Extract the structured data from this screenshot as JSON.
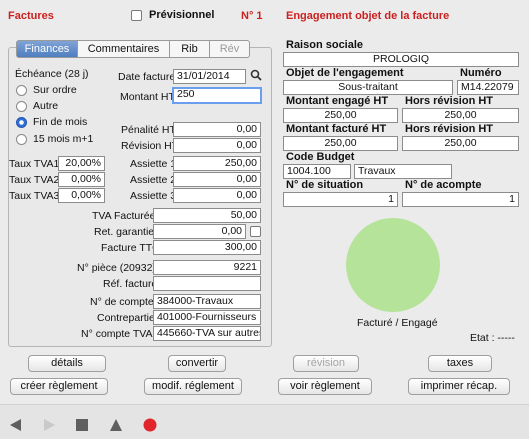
{
  "header": {
    "title": "Factures",
    "previsionnel_label": "Prévisionnel",
    "number": "N° 1",
    "engagement_title": "Engagement objet de la facture"
  },
  "tabs": [
    {
      "label": "Finances"
    },
    {
      "label": "Commentaires"
    },
    {
      "label": "Rib"
    },
    {
      "label": "Rév"
    }
  ],
  "finances": {
    "echeance_label": "Échéance (28 j)",
    "radios": [
      "Sur ordre",
      "Autre",
      "Fin de mois",
      "15 mois m+1"
    ],
    "date_facture_label": "Date facture",
    "date_facture": "31/01/2014",
    "montant_ht_label": "Montant HT",
    "montant_ht": "250",
    "penalite_label": "Pénalité HT",
    "penalite": "0,00",
    "revision_label": "Révision HT",
    "revision": "0,00",
    "tva": [
      {
        "label": "Taux TVA1",
        "rate": "20,00%",
        "assiette_label": "Assiette 1",
        "assiette": "250,00"
      },
      {
        "label": "Taux TVA2",
        "rate": "0,00%",
        "assiette_label": "Assiette 2",
        "assiette": "0,00"
      },
      {
        "label": "Taux TVA3",
        "rate": "0,00%",
        "assiette_label": "Assiette 3",
        "assiette": "0,00"
      }
    ],
    "tva_facturee_label": "TVA Facturée",
    "tva_facturee": "50,00",
    "ret_garantie_label": "Ret. garantie",
    "ret_garantie": "0,00",
    "facture_ttc_label": "Facture TTC",
    "facture_ttc": "300,00",
    "piece_label": "N° pièce (20932)",
    "piece": "9221",
    "ref_facture_label": "Réf. facture",
    "ref_facture": "",
    "compte_label": "N° de compte",
    "compte": "384000-Travaux",
    "contrepartie_label": "Contrepartie",
    "contrepartie": "401000-Fournisseurs",
    "compte_tva_label": "N° compte  TVA",
    "compte_tva": "445660-TVA sur autres b"
  },
  "engagement": {
    "raison_sociale_label": "Raison sociale",
    "raison_sociale": "PROLOGIQ",
    "objet_label": "Objet de l'engagement",
    "objet": "Sous-traitant",
    "numero_label": "Numéro",
    "numero": "M14.22079",
    "montant_engage_label": "Montant engagé HT",
    "montant_engage": "250,00",
    "hors_revision_label": "Hors révision HT",
    "hors_revision_1": "250,00",
    "montant_facture_label": "Montant facturé HT",
    "montant_facture": "250,00",
    "hors_revision_2": "250,00",
    "code_budget_label": "Code Budget",
    "code_budget": "1004.100",
    "code_budget_desc": "Travaux",
    "situation_label": "N° de situation",
    "situation": "1",
    "acompte_label": "N° de acompte",
    "acompte": "1",
    "pie_caption": "Facturé / Engagé",
    "pie_color": "#b6e39a",
    "etat": "Etat : -----"
  },
  "buttons_row1": [
    "détails",
    "convertir",
    "révision",
    "taxes"
  ],
  "buttons_row2": [
    "créer règlement",
    "modif. réglement",
    "voir règlement",
    "imprimer récap."
  ],
  "toolbar_icons": [
    "prev-icon",
    "next-icon",
    "stop-icon",
    "up-icon",
    "record-icon"
  ]
}
